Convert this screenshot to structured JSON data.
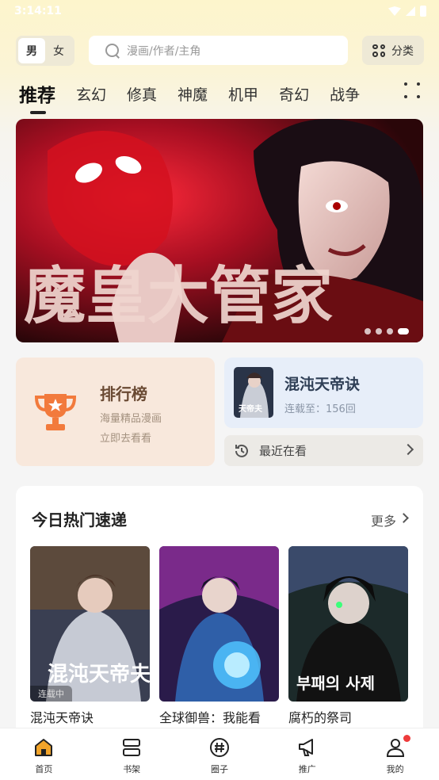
{
  "status_bar": {
    "time": "3:14:11"
  },
  "header": {
    "gender": {
      "male": "男",
      "female": "女",
      "selected": "male"
    },
    "search": {
      "placeholder": "漫画/作者/主角"
    },
    "category_label": "分类"
  },
  "tabs": [
    {
      "label": "推荐",
      "active": true
    },
    {
      "label": "玄幻"
    },
    {
      "label": "修真"
    },
    {
      "label": "神魔"
    },
    {
      "label": "机甲"
    },
    {
      "label": "奇幻"
    },
    {
      "label": "战争"
    }
  ],
  "banner": {
    "artwork_text": "魔皇大管家",
    "slide_count": 4,
    "active_slide": 4
  },
  "ranking_card": {
    "title": "排行榜",
    "subtitle1": "海量精品漫画",
    "subtitle2": "立即去看看",
    "icon": "trophy-icon"
  },
  "continue_reading": {
    "title": "混沌天帝诀",
    "progress": "连载至：156回",
    "cover_text": "天帝夫"
  },
  "recent": {
    "label": "最近在看"
  },
  "hot": {
    "title": "今日热门速递",
    "more": "更多",
    "comics": [
      {
        "title": "混沌天帝诀",
        "badge": "连载中",
        "cover_text": "混沌天帝夫"
      },
      {
        "title": "全球御兽：我能看",
        "badge": "",
        "cover_text": ""
      },
      {
        "title": "腐朽的祭司",
        "badge": "",
        "cover_text": "부패의 사제"
      }
    ]
  },
  "bottom_nav": [
    {
      "label": "首页",
      "icon": "home-icon",
      "active": true
    },
    {
      "label": "书架",
      "icon": "bookshelf-icon"
    },
    {
      "label": "圈子",
      "icon": "hashtag-icon"
    },
    {
      "label": "推广",
      "icon": "megaphone-icon"
    },
    {
      "label": "我的",
      "icon": "profile-icon",
      "badge": true
    }
  ],
  "colors": {
    "accent": "#f2a42a",
    "rank_card_bg": "#f8e8dc",
    "continue_card_bg": "#e7eef9",
    "notification_dot": "#ee3b3b"
  }
}
